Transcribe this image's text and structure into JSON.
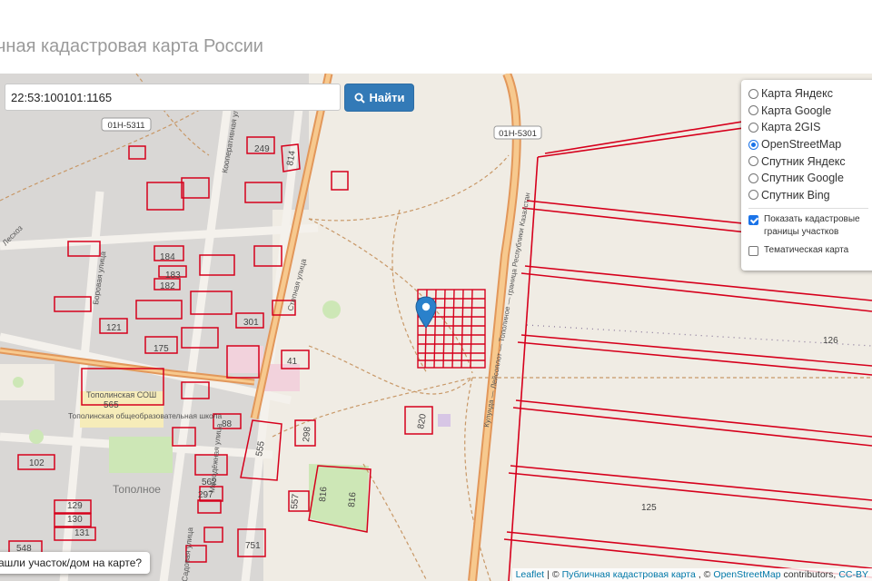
{
  "header": {
    "title": "чная кадастровая карта России"
  },
  "search": {
    "value": "22:53:100101:1165",
    "button_label": "Найти",
    "icon": "search-icon"
  },
  "layers": {
    "base": [
      {
        "label": "Карта Яндекс",
        "selected": false
      },
      {
        "label": "Карта Google",
        "selected": false
      },
      {
        "label": "Карта 2GIS",
        "selected": false
      },
      {
        "label": "OpenStreetMap",
        "selected": true
      },
      {
        "label": "Спутник Яндекс",
        "selected": false
      },
      {
        "label": "Спутник Google",
        "selected": false
      },
      {
        "label": "Спутник Bing",
        "selected": false
      }
    ],
    "overlays": [
      {
        "label": "Показать кадастровые границы участков",
        "checked": true
      },
      {
        "label": "Тематическая карта",
        "checked": false
      }
    ]
  },
  "help": {
    "text": "ашли участок/дом на карте?"
  },
  "attribution": {
    "leaflet": "Leaflet",
    "sep1": "|",
    "copy": "©",
    "pkk": "Публичная кадастровая карта",
    "sep2": ", ©",
    "osm": "OpenStreetMap",
    "contributors": "contributors,",
    "cc": "CC-BY"
  },
  "map": {
    "road_labels": [
      "01Н-5311",
      "01Н-5301"
    ],
    "street_labels": [
      "Кооперативная ул.",
      "Степная улица",
      "Боровая улица",
      "Молодёжная улица",
      "Садовая улица",
      "Лесхоз",
      "Кулунда — Лейсоплот — Тополиное — граница Республики Казахстан"
    ],
    "place_labels": [
      "Тополинская СОШ",
      "Тополинская общеобразовательная школа",
      "Тополное"
    ],
    "parcel_numbers": [
      "249",
      "814",
      "184",
      "183",
      "182",
      "121",
      "175",
      "301",
      "41",
      "88",
      "298",
      "555",
      "562",
      "297",
      "557",
      "816",
      "816",
      "751",
      "820",
      "129",
      "130",
      "131",
      "102",
      "548",
      "565",
      "126",
      "125"
    ],
    "colors": {
      "parcel": "#d6001c",
      "road": "#e8a66a",
      "background": "#f0ece4",
      "built": "#d8d6d4",
      "green": "#cbe5b4",
      "marker": "#2a81cb"
    }
  }
}
